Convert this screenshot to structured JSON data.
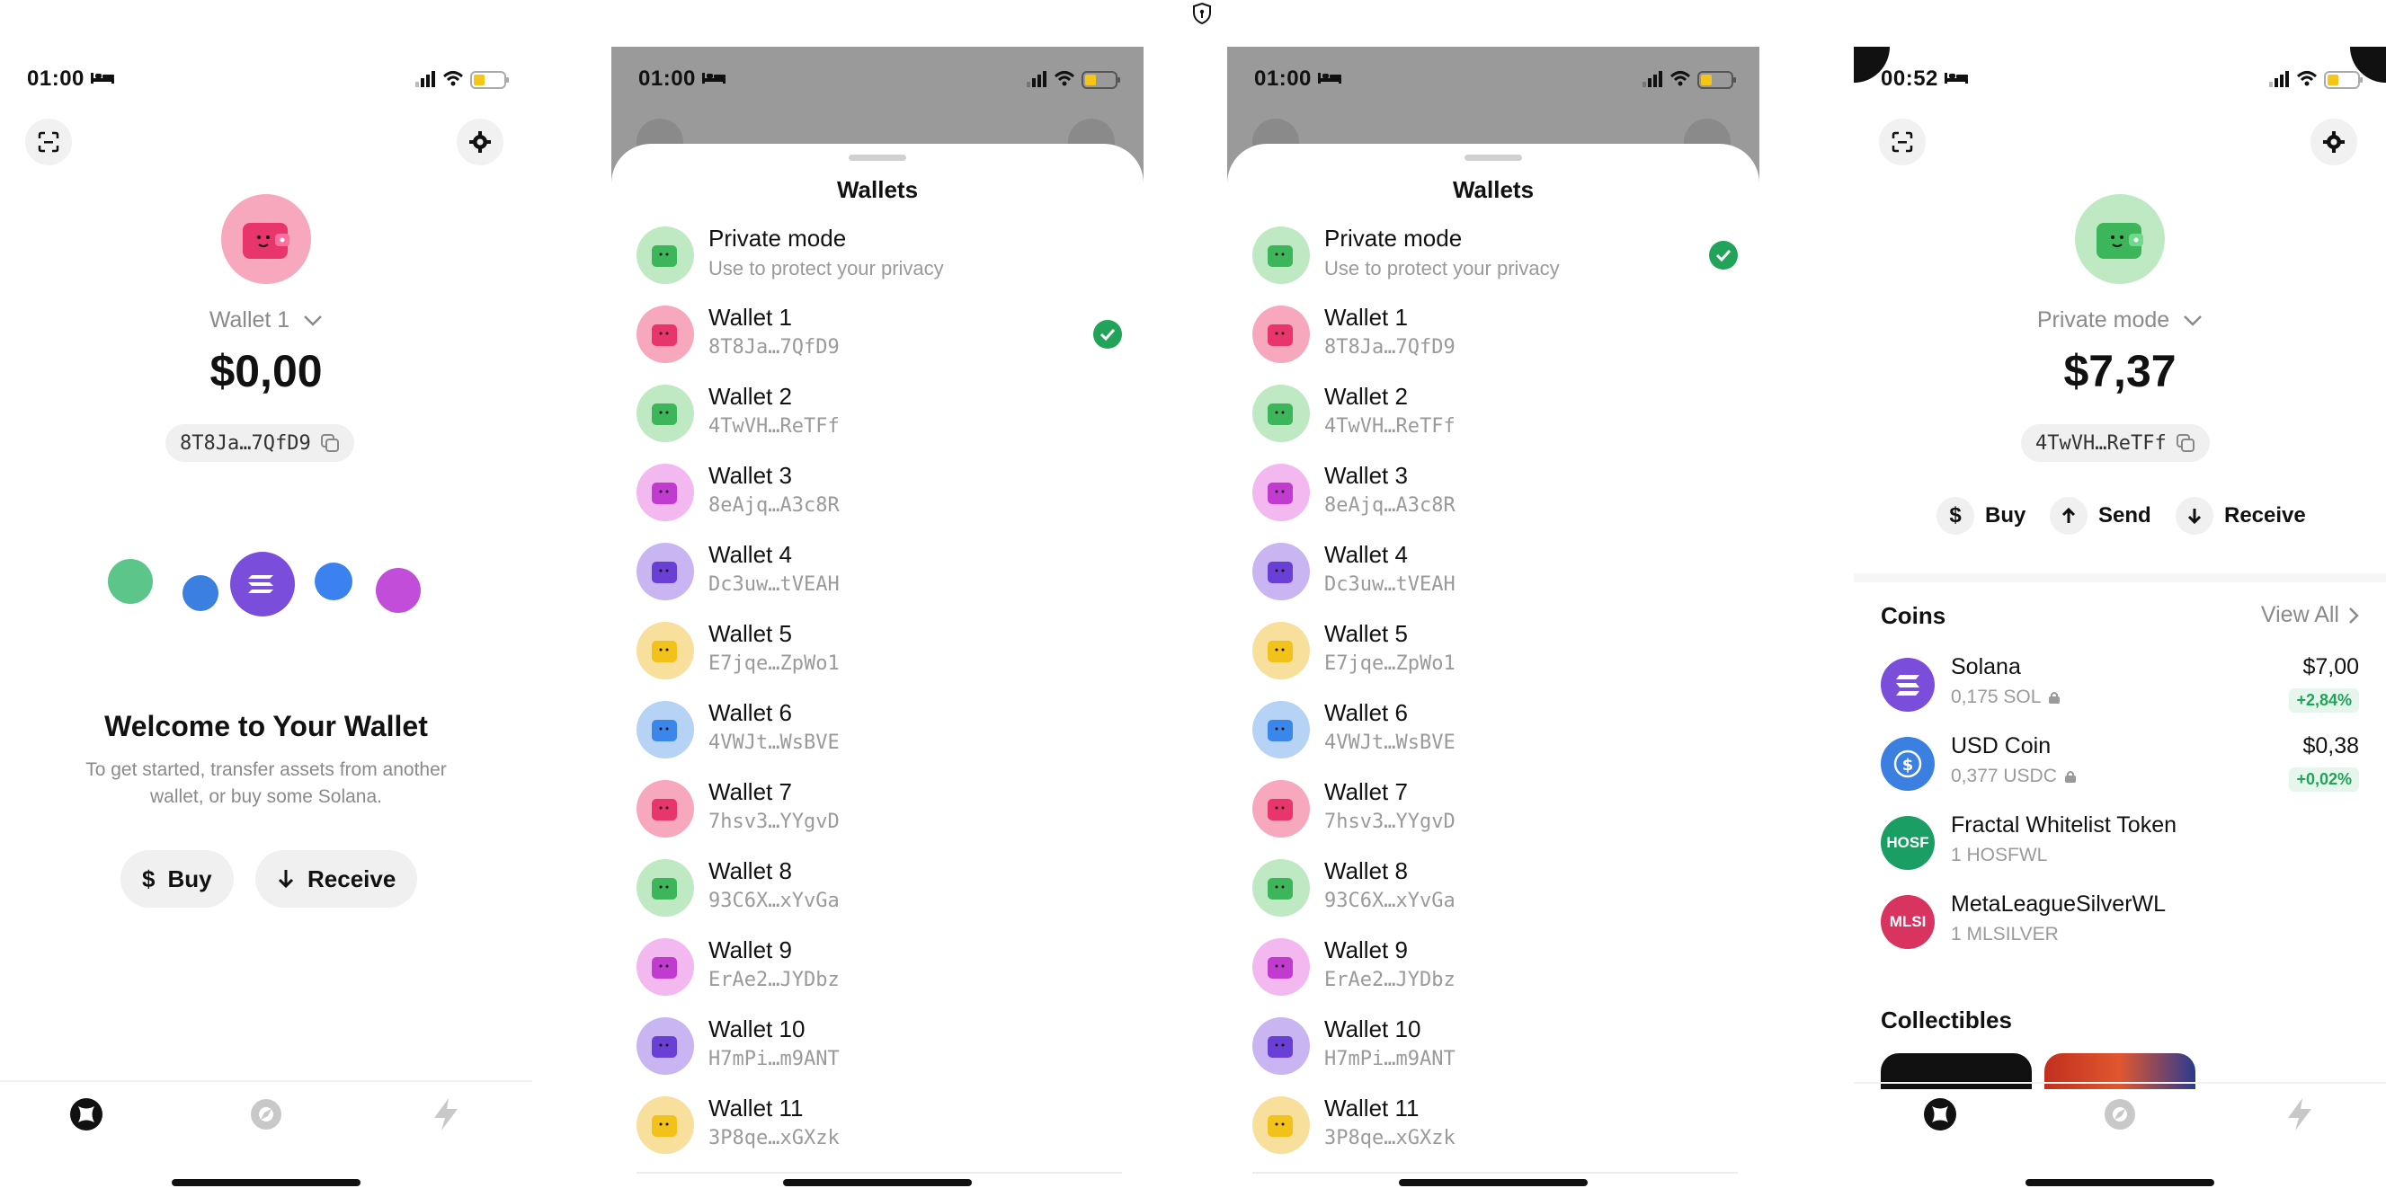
{
  "colors": {
    "green_check": "#21a35a",
    "solana_purple": "#7b4ddb",
    "usdc_blue": "#3b7fe0",
    "hosf_green": "#1a9e63",
    "mlsi_red": "#d8345f"
  },
  "phone1": {
    "status": {
      "time": "01:00"
    },
    "wallet_name": "Wallet 1",
    "balance": "$0,00",
    "address": "8T8Ja…7QfD9",
    "welcome_title": "Welcome to Your Wallet",
    "welcome_text": "To get started, transfer assets from another wallet, or buy some Solana.",
    "buy_label": "Buy",
    "receive_label": "Receive"
  },
  "sheet": {
    "status_time": "01:00",
    "title": "Wallets",
    "private": {
      "title": "Private mode",
      "subtitle": "Use to protect your privacy"
    },
    "wallets": [
      {
        "name": "Wallet 1",
        "addr": "8T8Ja…7QfD9",
        "color": "#f7a8bd"
      },
      {
        "name": "Wallet 2",
        "addr": "4TwVH…ReTFf",
        "color": "#bfe9c2"
      },
      {
        "name": "Wallet 3",
        "addr": "8eAjq…A3c8R",
        "color": "#f4b8f0"
      },
      {
        "name": "Wallet 4",
        "addr": "Dc3uw…tVEAH",
        "color": "#c9b5f2"
      },
      {
        "name": "Wallet 5",
        "addr": "E7jqe…ZpWo1",
        "color": "#f8df9b"
      },
      {
        "name": "Wallet 6",
        "addr": "4VWJt…WsBVE",
        "color": "#b6d2f5"
      },
      {
        "name": "Wallet 7",
        "addr": "7hsv3…YYgvD",
        "color": "#f7a8bd"
      },
      {
        "name": "Wallet 8",
        "addr": "93C6X…xYvGa",
        "color": "#bfe9c2"
      },
      {
        "name": "Wallet 9",
        "addr": "ErAe2…JYDbz",
        "color": "#f4b8f0"
      },
      {
        "name": "Wallet 10",
        "addr": "H7mPi…m9ANT",
        "color": "#c9b5f2"
      },
      {
        "name": "Wallet 11",
        "addr": "3P8qe…xGXzk",
        "color": "#f8df9b"
      }
    ]
  },
  "phone4": {
    "status": {
      "time": "00:52"
    },
    "wallet_name": "Private mode",
    "balance": "$7,37",
    "address": "4TwVH…ReTFf",
    "actions": {
      "buy": "Buy",
      "send": "Send",
      "receive": "Receive"
    },
    "coins_title": "Coins",
    "view_all": "View All",
    "coins": [
      {
        "name": "Solana",
        "amount": "0,175 SOL",
        "value": "$7,00",
        "change": "+2,84%"
      },
      {
        "name": "USD Coin",
        "amount": "0,377 USDC",
        "value": "$0,38",
        "change": "+0,02%"
      },
      {
        "name": "Fractal Whitelist Token",
        "amount": "1 HOSFWL",
        "badge": "HOSF"
      },
      {
        "name": "MetaLeagueSilverWL",
        "amount": "1 MLSILVER",
        "badge": "MLSI"
      }
    ],
    "collectibles_title": "Collectibles"
  }
}
